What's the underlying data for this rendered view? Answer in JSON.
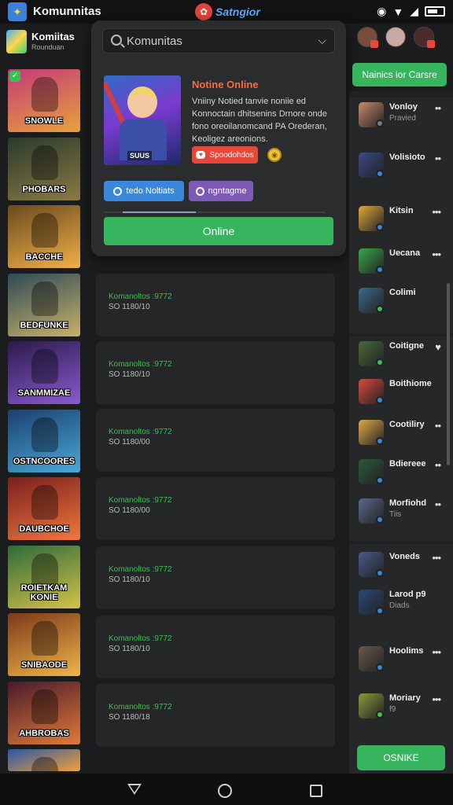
{
  "status_bar": {
    "app_title": "Komunnitas",
    "center_text": "Satngior",
    "icons": [
      "app-logo-icon",
      "location-pin-icon",
      "alarm-icon",
      "wifi-icon",
      "signal-icon",
      "battery-icon"
    ]
  },
  "left_header": {
    "title": "Komiitas",
    "subtitle": "Rounduan"
  },
  "games": [
    {
      "label": "SNOWLE",
      "colors": [
        "#c4397a",
        "#e8a23a"
      ],
      "checked": true
    },
    {
      "label": "PHOBARS",
      "colors": [
        "#2a3a2a",
        "#8b7a45"
      ],
      "checked": false
    },
    {
      "label": "BACCHE",
      "colors": [
        "#6b4a1c",
        "#f0b04a"
      ],
      "checked": false
    },
    {
      "label": "BEDFUNKE",
      "colors": [
        "#2f4a56",
        "#c7b16a"
      ],
      "checked": false
    },
    {
      "label": "SANMMIZAE",
      "colors": [
        "#2a1a4a",
        "#8a5bd0"
      ],
      "checked": false
    },
    {
      "label": "OSTNCOORES",
      "colors": [
        "#1d3f6d",
        "#48a9d8"
      ],
      "checked": false
    },
    {
      "label": "DAUBCHOE",
      "colors": [
        "#7a1e1e",
        "#f0783c"
      ],
      "checked": false
    },
    {
      "label": "ROIETKAM KONIE",
      "colors": [
        "#2e6a3a",
        "#d4c24a"
      ],
      "checked": false
    },
    {
      "label": "SNIBAODE",
      "colors": [
        "#7a3a1a",
        "#f2b44a"
      ],
      "checked": false
    },
    {
      "label": "AHBROBAS",
      "colors": [
        "#4a1a2a",
        "#e07a3a"
      ],
      "checked": false
    },
    {
      "label": "",
      "colors": [
        "#2a56a8",
        "#f0a23a"
      ],
      "checked": false
    }
  ],
  "mid_list": [
    {
      "title": "Komanoltos :9772",
      "sub": "SO 1180/10"
    },
    {
      "title": "Komanoltos :9772",
      "sub": "SO 1180/10"
    },
    {
      "title": "Komanoltos :9772",
      "sub": "SO 1180/00"
    },
    {
      "title": "Komanoltos :9772",
      "sub": "SO 1180/00"
    },
    {
      "title": "Komanoltos :9772",
      "sub": "SO 1180/10"
    },
    {
      "title": "Komanoltos :9772",
      "sub": "SO 1180/10"
    },
    {
      "title": "Komanoltos :9772",
      "sub": "SO 1180/18"
    },
    {
      "title": "Komanoltos :9772",
      "sub": "SO 1180/10"
    }
  ],
  "popup": {
    "search_placeholder": "Komunitas",
    "hero_tag": "SUUS",
    "title": "Notine Online",
    "description": "Vniiny Notied tanvie noniie ed Konnoctain dhitsenins Drnore onde fono oreoilanomcand PA Orederan, Keoligez areonions.",
    "badge_red": "Spoodohdos",
    "chip_blue": "tedo Noltiats",
    "chip_purple": "ngntagme",
    "online_button": "Online",
    "progress": 0.33
  },
  "right_panel": {
    "cta_top": "Nainics ior Carsre",
    "contacts": [
      {
        "name": "Vonloy",
        "sub": "Pravied",
        "more": "••",
        "avatar": "#c98a6a",
        "status": "#7a7a7a"
      },
      {
        "name": "Volisioto",
        "sub": "",
        "more": "••",
        "avatar": "#3a4a8a",
        "status": "#3b87dc"
      },
      {
        "name": "Kitsin",
        "sub": "",
        "more": "•••",
        "avatar": "#e0a83a",
        "status": "#3b87dc"
      },
      {
        "name": "Uecana",
        "sub": "",
        "more": "•••",
        "avatar": "#3aa84a",
        "status": "#3b87dc"
      },
      {
        "name": "Colimi",
        "sub": "",
        "more": "",
        "avatar": "#3a6a8a",
        "status": "#3cbf55"
      },
      {
        "name": "Coitigne",
        "sub": "",
        "more": "♥",
        "avatar": "#4a6a3a",
        "status": "#3cbf55"
      },
      {
        "name": "Boithiome",
        "sub": "",
        "more": "",
        "avatar": "#d84a3a",
        "status": "#3b87dc"
      },
      {
        "name": "Cootiliry",
        "sub": "",
        "more": "••",
        "avatar": "#e0a84a",
        "status": "#3b87dc"
      },
      {
        "name": "Bdiereee",
        "sub": "",
        "more": "••",
        "avatar": "#2a5a3a",
        "status": "#3b87dc"
      },
      {
        "name": "Morfiohd",
        "sub": "Tiis",
        "more": "••",
        "avatar": "#5a6a8a",
        "status": "#3b87dc"
      },
      {
        "name": "Voneds",
        "sub": "",
        "more": "•••",
        "avatar": "#4a5a8a",
        "status": "#3b87dc"
      },
      {
        "name": "Larod p9",
        "sub": "Diads",
        "more": "",
        "avatar": "#2a4a7a",
        "status": "#3b87dc"
      },
      {
        "name": "Hoolims",
        "sub": "",
        "more": "•••",
        "avatar": "#6a5a4a",
        "status": "#3b87dc"
      },
      {
        "name": "Moriary",
        "sub": "f9",
        "more": "•••",
        "avatar": "#8a9a3a",
        "status": "#3cbf55"
      }
    ],
    "cta_bottom": "OSNIKE"
  },
  "nav_bar": {
    "icons": [
      "back-icon",
      "home-icon",
      "recents-icon"
    ]
  },
  "colors": {
    "accent_green": "#36b55e",
    "accent_orange": "#ff6a3d",
    "background": "#1b1c1d"
  }
}
